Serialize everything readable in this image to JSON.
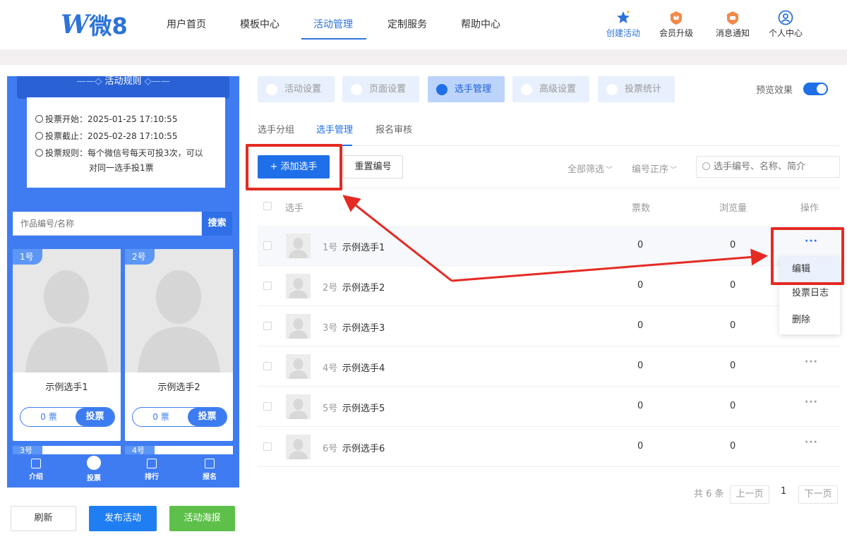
{
  "header": {
    "logo_mark": "W",
    "logo_text": "微8",
    "nav": [
      "用户首页",
      "模板中心",
      "活动管理",
      "定制服务",
      "帮助中心"
    ],
    "nav_active_index": 2,
    "quick_actions": [
      "创建活动",
      "会员升级",
      "消息通知",
      "个人中心"
    ]
  },
  "preview": {
    "rules_title": "活动规则",
    "rule_start": "投票开始：2025-01-25 17:10:55",
    "rule_end": "投票截止：2025-02-28 17:10:55",
    "rule_text_1": "投票规则：每个微信号每天可投3次，可以",
    "rule_text_2": "对同一选手投1票",
    "search_placeholder": "作品编号/名称",
    "search_button": "搜索",
    "cards": [
      {
        "no": "1号",
        "name": "示例选手1",
        "votes": "0 票",
        "vote_button": "投票"
      },
      {
        "no": "2号",
        "name": "示例选手2",
        "votes": "0 票",
        "vote_button": "投票"
      }
    ],
    "peek_cards": [
      "3号",
      "4号"
    ],
    "tabs": [
      "介绍",
      "投票",
      "排行",
      "报名"
    ]
  },
  "actions": {
    "refresh": "刷新",
    "publish": "发布活动",
    "poster": "活动海报"
  },
  "steps": [
    "活动设置",
    "页面设置",
    "选手管理",
    "高级设置",
    "投票统计"
  ],
  "step_active_index": 2,
  "preview_toggle_label": "预览效果",
  "subtabs": [
    "选手分组",
    "选手管理",
    "报名审核"
  ],
  "toolbar": {
    "add": "+ 添加选手",
    "reset": "重置编号",
    "filter_all": "全部筛选",
    "sort": "编号正序",
    "search_placeholder": "选手编号、名称、简介"
  },
  "table": {
    "headers": [
      "选手",
      "票数",
      "浏览量",
      "操作"
    ],
    "more": "···",
    "rows": [
      {
        "no": "1号",
        "name": "示例选手1",
        "votes": "0",
        "views": "0"
      },
      {
        "no": "2号",
        "name": "示例选手2",
        "votes": "0",
        "views": "0"
      },
      {
        "no": "3号",
        "name": "示例选手3",
        "votes": "0",
        "views": "0"
      },
      {
        "no": "4号",
        "name": "示例选手4",
        "votes": "0",
        "views": "0"
      },
      {
        "no": "5号",
        "name": "示例选手5",
        "votes": "0",
        "views": "0"
      },
      {
        "no": "6号",
        "name": "示例选手6",
        "votes": "0",
        "views": "0"
      }
    ]
  },
  "row_menu": [
    "编辑",
    "投票日志",
    "删除"
  ],
  "pagination": {
    "total": "共 6 条",
    "prev": "上一页",
    "page": "1",
    "next": "下一页"
  },
  "colors": {
    "primary": "#1f6fe8",
    "annotation": "#e52a24",
    "poster_green": "#5ec04a"
  }
}
